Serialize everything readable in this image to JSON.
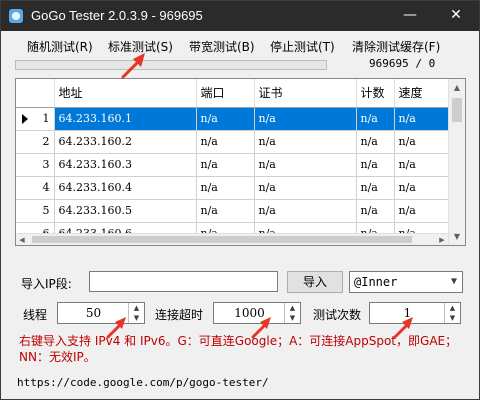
{
  "window": {
    "title": "GoGo Tester 2.0.3.9 - 969695",
    "minimize_glyph": "—",
    "close_glyph": "✕"
  },
  "menu": {
    "random_test": "随机测试(R)",
    "standard_test": "标准测试(S)",
    "bandwidth_test": "带宽测试(B)",
    "stop_test": "停止测试(T)",
    "clear_cache": "清除测试缓存(F)"
  },
  "progress": {
    "value": 0.0,
    "count_text": "969695 / 0"
  },
  "grid": {
    "columns": [
      "",
      "地址",
      "端口",
      "证书",
      "计数",
      "速度"
    ],
    "rows": [
      {
        "num": "1",
        "addr": "64.233.160.1",
        "port": "n/a",
        "cert": "n/a",
        "count": "n/a",
        "speed": "n/a",
        "selected": true
      },
      {
        "num": "2",
        "addr": "64.233.160.2",
        "port": "n/a",
        "cert": "n/a",
        "count": "n/a",
        "speed": "n/a"
      },
      {
        "num": "3",
        "addr": "64.233.160.3",
        "port": "n/a",
        "cert": "n/a",
        "count": "n/a",
        "speed": "n/a"
      },
      {
        "num": "4",
        "addr": "64.233.160.4",
        "port": "n/a",
        "cert": "n/a",
        "count": "n/a",
        "speed": "n/a"
      },
      {
        "num": "5",
        "addr": "64.233.160.5",
        "port": "n/a",
        "cert": "n/a",
        "count": "n/a",
        "speed": "n/a"
      },
      {
        "num": "6",
        "addr": "64.233.160.6",
        "port": "n/a",
        "cert": "n/a",
        "count": "n/a",
        "speed": "n/a"
      }
    ]
  },
  "import": {
    "label": "导入IP段:",
    "value": "",
    "button": "导入",
    "selected_option": "@Inner"
  },
  "settings": {
    "threads_label": "线程",
    "threads_value": "50",
    "timeout_label": "连接超时",
    "timeout_value": "1000",
    "tries_label": "测试次数",
    "tries_value": "1"
  },
  "hint": "右键导入支持 IPv4 和 IPv6。G：可直连Google；A：可连接AppSpot，即GAE；NN：无效IP。",
  "footer_url": "https://code.google.com/p/gogo-tester/",
  "colors": {
    "selection": "#0078d7",
    "hint": "#c00000",
    "pointer": "#e8352a",
    "titlebar": "#2b2b2b"
  }
}
